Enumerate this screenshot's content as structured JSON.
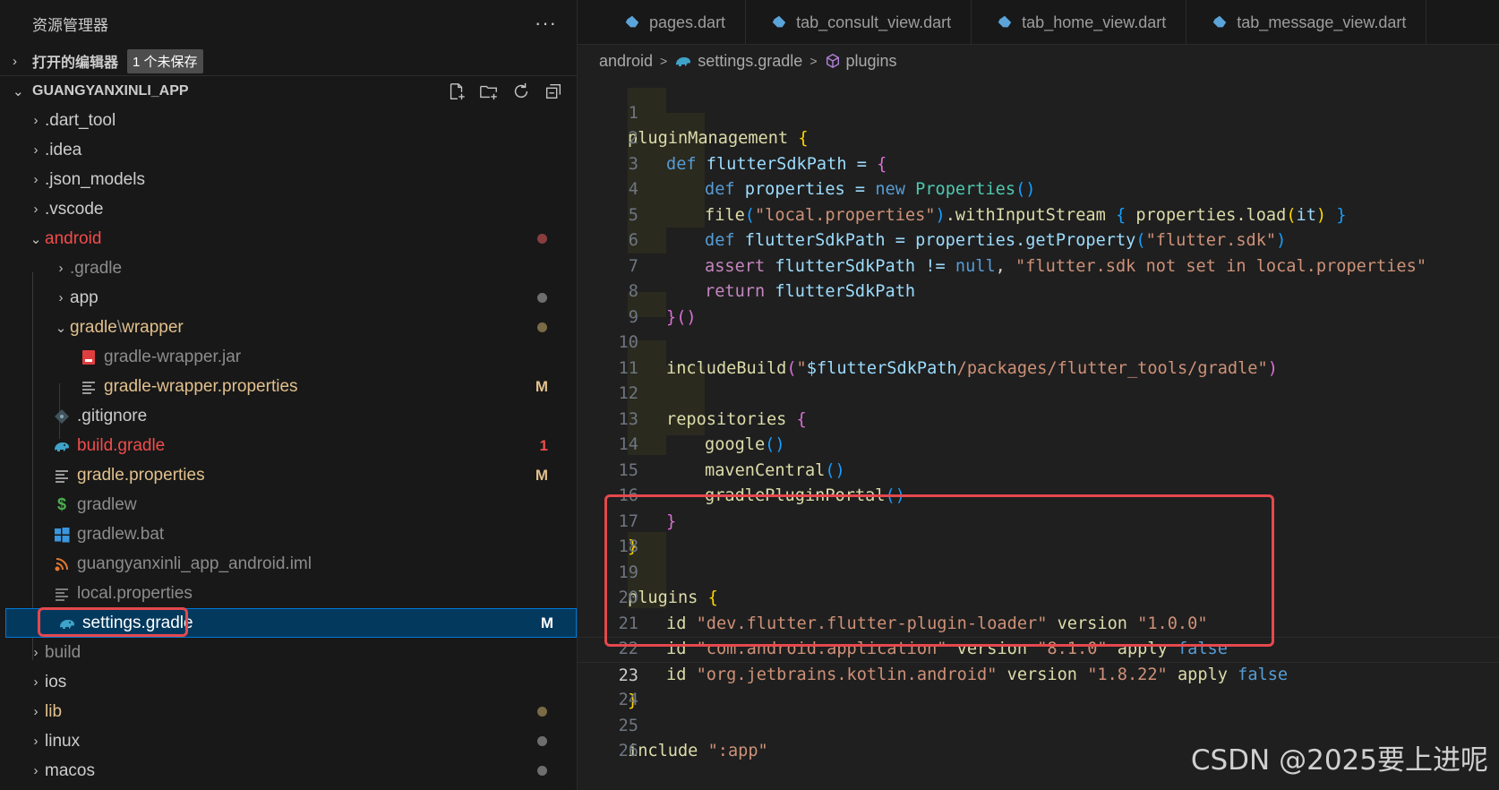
{
  "explorer": {
    "title": "资源管理器",
    "more_label": "···",
    "open_editors": {
      "label": "打开的编辑器",
      "badge": "1 个未保存"
    },
    "root": {
      "label": "GUANGYANXINLI_APP"
    },
    "items": [
      {
        "label": ".dart_tool",
        "color": "#cccccc"
      },
      {
        "label": ".idea",
        "color": "#cccccc"
      },
      {
        "label": ".json_models",
        "color": "#cccccc"
      },
      {
        "label": ".vscode",
        "color": "#cccccc"
      },
      {
        "label": "android",
        "color": "#f14c4c"
      },
      {
        "label": ".gradle",
        "color": "#8c8c8c"
      },
      {
        "label": "app",
        "color": "#cccccc"
      },
      {
        "label": "gradle",
        "label2": "wrapper",
        "color": "#e2c08d"
      },
      {
        "label": "gradle-wrapper.jar",
        "color": "#8c8c8c"
      },
      {
        "label": "gradle-wrapper.properties",
        "color": "#e2c08d",
        "badge": "M"
      },
      {
        "label": ".gitignore",
        "color": "#cccccc"
      },
      {
        "label": "build.gradle",
        "color": "#f14c4c",
        "badge": "1"
      },
      {
        "label": "gradle.properties",
        "color": "#e2c08d",
        "badge": "M"
      },
      {
        "label": "gradlew",
        "color": "#8c8c8c"
      },
      {
        "label": "gradlew.bat",
        "color": "#8c8c8c"
      },
      {
        "label": "guangyanxinli_app_android.iml",
        "color": "#8c8c8c"
      },
      {
        "label": "local.properties",
        "color": "#8c8c8c"
      },
      {
        "label": "settings.gradle",
        "color": "#ffffff",
        "badge": "M"
      },
      {
        "label": "build",
        "color": "#8c8c8c"
      },
      {
        "label": "ios",
        "color": "#cccccc"
      },
      {
        "label": "lib",
        "color": "#e2c08d"
      },
      {
        "label": "linux",
        "color": "#cccccc"
      },
      {
        "label": "macos",
        "color": "#cccccc"
      }
    ]
  },
  "tabs": [
    {
      "label": "pages.dart"
    },
    {
      "label": "tab_consult_view.dart"
    },
    {
      "label": "tab_home_view.dart"
    },
    {
      "label": "tab_message_view.dart"
    }
  ],
  "breadcrumb": {
    "part1": "android",
    "part2": "settings.gradle",
    "part3": "plugins"
  },
  "line_numbers": [
    "1",
    "2",
    "3",
    "4",
    "5",
    "6",
    "7",
    "8",
    "9",
    "10",
    "11",
    "12",
    "13",
    "14",
    "15",
    "16",
    "17",
    "18",
    "19",
    "20",
    "21",
    "22",
    "23",
    "24",
    "25",
    "26"
  ],
  "code": {
    "l1": [
      "pluginManagement",
      " ",
      "{"
    ],
    "l2": [
      "def",
      " flutterSdkPath = ",
      "{"
    ],
    "l3": [
      "def",
      " properties = ",
      "new",
      " ",
      "Properties",
      "(",
      ")"
    ],
    "l4": [
      "file",
      "(",
      "\"local.properties\"",
      ")",
      ".withInputStream ",
      "{",
      " properties.load",
      "(",
      "it",
      ")",
      " ",
      "}"
    ],
    "l5": [
      "def",
      " flutterSdkPath = properties.getProperty",
      "(",
      "\"flutter.sdk\"",
      ")"
    ],
    "l6": [
      "assert",
      " flutterSdkPath != ",
      "null",
      ", ",
      "\"flutter.sdk not set in local.properties\""
    ],
    "l7": [
      "return",
      " flutterSdkPath"
    ],
    "l8": [
      "}",
      "(",
      ")"
    ],
    "l10": [
      "includeBuild",
      "(",
      "\"",
      "$flutterSdkPath",
      "/packages/flutter_tools/gradle\"",
      ")"
    ],
    "l12": [
      "repositories",
      " ",
      "{"
    ],
    "l13": [
      "google",
      "(",
      ")"
    ],
    "l14": [
      "mavenCentral",
      "(",
      ")"
    ],
    "l15": [
      "gradlePluginPortal",
      "(",
      ")"
    ],
    "l16": [
      "}"
    ],
    "l17": [
      "}"
    ],
    "l19": [
      "plugins",
      " ",
      "{"
    ],
    "l20": [
      "id",
      " ",
      "\"dev.flutter.flutter-plugin-loader\"",
      " version ",
      "\"1.0.0\""
    ],
    "l21": [
      "id",
      " ",
      "\"com.android.application\"",
      " version ",
      "\"8.1.0\"",
      " apply ",
      "false"
    ],
    "l22": [
      "id",
      " ",
      "\"org.jetbrains.kotlin.android\"",
      " version ",
      "\"1.8.22\"",
      " apply ",
      "false"
    ],
    "l23": [
      "}"
    ],
    "l25": [
      "include",
      " ",
      "\":app\""
    ]
  },
  "watermark": "CSDN @2025要上进呢"
}
